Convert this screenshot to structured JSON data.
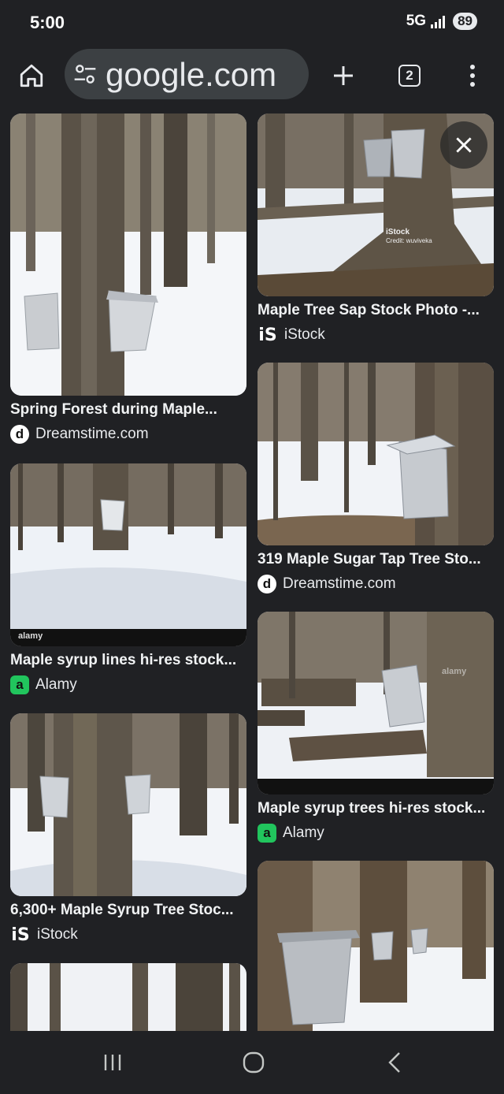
{
  "status_bar": {
    "time": "5:00",
    "network": "5G",
    "battery": "89"
  },
  "toolbar": {
    "url": "google.com",
    "tab_count": "2"
  },
  "results_left": [
    {
      "caption": "Spring Forest during Maple...",
      "source": "Dreamstime.com",
      "favicon": "d"
    },
    {
      "caption": "Maple syrup lines hi-res stock...",
      "source": "Alamy",
      "favicon": "a"
    },
    {
      "caption": "6,300+ Maple Syrup Tree Stoc...",
      "source": "iStock",
      "favicon": "iS"
    }
  ],
  "results_right": [
    {
      "caption": "Maple Tree Sap Stock Photo -...",
      "source": "iStock",
      "favicon": "iS"
    },
    {
      "caption": "319 Maple Sugar Tap Tree Sto...",
      "source": "Dreamstime.com",
      "favicon": "d"
    },
    {
      "caption": "Maple syrup trees hi-res stock...",
      "source": "Alamy",
      "favicon": "a"
    }
  ],
  "image_overlays": {
    "istock_watermark": "iStock",
    "istock_credit": "Credit: wuviveka",
    "alamy_mark": "alamy"
  },
  "icons": {
    "home": "home-icon",
    "tune": "tune-icon",
    "new_tab": "plus-icon",
    "tabs": "tab-switcher-icon",
    "menu": "more-vert-icon",
    "close": "close-icon",
    "recents": "recents-icon",
    "home_nav": "home-nav-icon",
    "back": "back-icon"
  },
  "colors": {
    "background": "#202124",
    "omnibox": "#3c4043",
    "text": "#e8eaed",
    "alamy_green": "#21c55d"
  }
}
